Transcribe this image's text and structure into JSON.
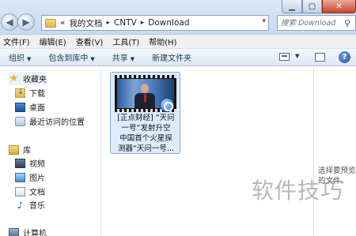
{
  "address": {
    "overflow_chevron": "«",
    "crumbs": [
      "我的文档",
      "CNTV",
      "Download"
    ],
    "separator": "▸"
  },
  "search": {
    "placeholder": "搜索 Download"
  },
  "menu": [
    "文件(F)",
    "编辑(E)",
    "查看(V)",
    "工具(T)",
    "帮助(H)"
  ],
  "commands": {
    "organize": "组织",
    "include_in_library": "包含到库中",
    "share": "共享",
    "new_folder": "新建文件夹"
  },
  "nav": {
    "favorites": "收藏夹",
    "favorites_items": [
      "下载",
      "桌面",
      "最近访问的位置"
    ],
    "libraries": "库",
    "library_items": [
      "视频",
      "图片",
      "文档",
      "音乐"
    ],
    "computer": "计算机"
  },
  "file": {
    "name_lines": [
      "[正点财经] “天问",
      "一号”发射升空",
      "中国首个火星探",
      "测器“天问一号..."
    ]
  },
  "preview": {
    "text_lines": [
      "选择要预览",
      "的文件。"
    ]
  },
  "watermark": "软件技巧",
  "colors": {
    "accent": "#2a63b8",
    "selection": "#dcecfc",
    "close": "#c8452f"
  }
}
